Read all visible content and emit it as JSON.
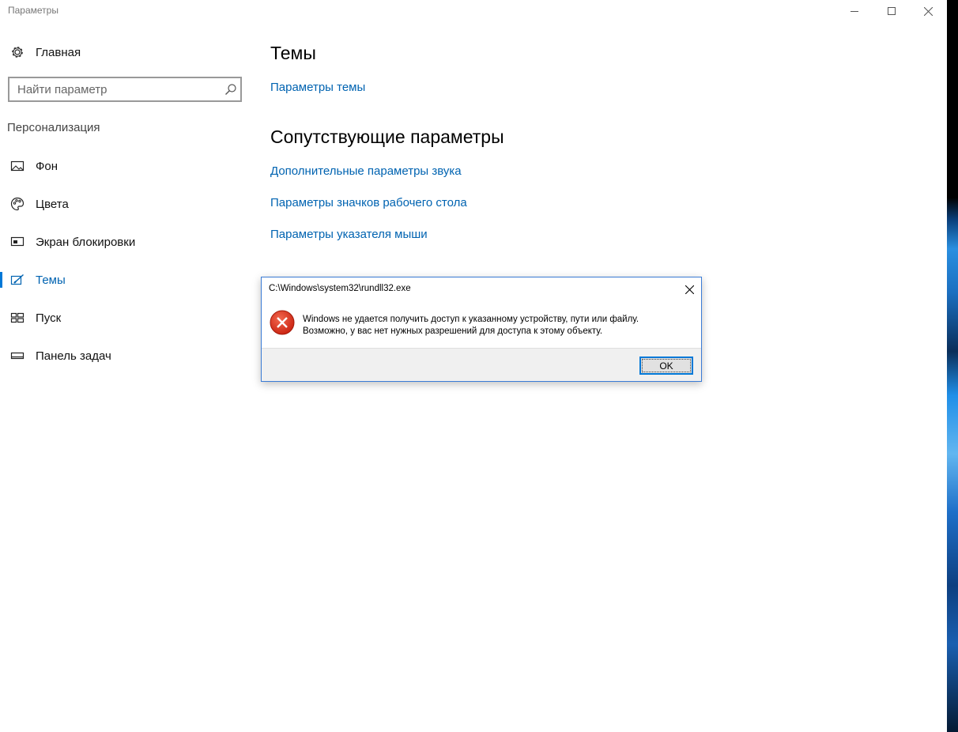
{
  "window": {
    "title": "Параметры"
  },
  "sidebar": {
    "home_label": "Главная",
    "search_placeholder": "Найти параметр",
    "section_label": "Персонализация",
    "items": [
      {
        "label": "Фон",
        "icon": "picture-icon"
      },
      {
        "label": "Цвета",
        "icon": "palette-icon"
      },
      {
        "label": "Экран блокировки",
        "icon": "monitor-icon"
      },
      {
        "label": "Темы",
        "icon": "themes-icon",
        "active": true
      },
      {
        "label": "Пуск",
        "icon": "start-tiles-icon"
      },
      {
        "label": "Панель задач",
        "icon": "taskbar-icon"
      }
    ]
  },
  "main": {
    "title": "Темы",
    "theme_settings_link": "Параметры темы",
    "related_title": "Сопутствующие параметры",
    "related_links": [
      "Дополнительные параметры звука",
      "Параметры значков рабочего стола",
      "Параметры указателя мыши"
    ]
  },
  "dialog": {
    "title": "C:\\Windows\\system32\\rundll32.exe",
    "message_line1": "Windows не удается получить доступ к указанному устройству, пути или файлу.",
    "message_line2": "Возможно, у вас нет нужных разрешений для доступа к этому объекту.",
    "ok_label": "OK",
    "icon": "error-icon"
  },
  "colors": {
    "accent": "#0078d7",
    "link": "#0063b1",
    "error": "#e81123"
  }
}
